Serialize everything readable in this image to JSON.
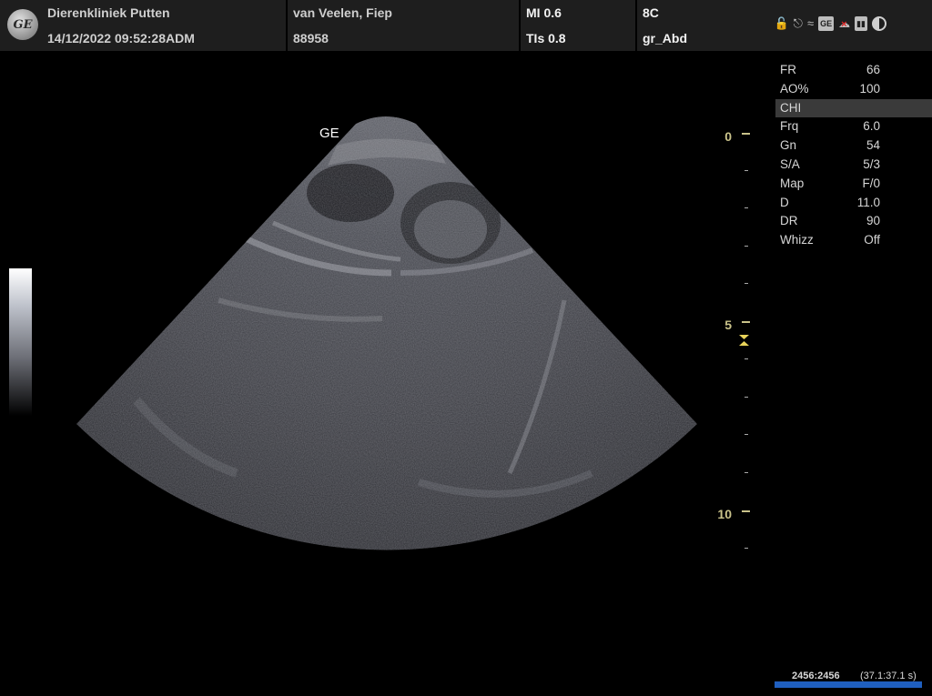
{
  "header": {
    "clinic_name": "Dierenkliniek Putten",
    "datetime": "14/12/2022 09:52:28ADM",
    "patient_name": "van Veelen, Fiep",
    "patient_id": "88958",
    "mi": "MI 0.6",
    "tis": "TIs 0.8",
    "probe": "8C",
    "preset": "gr_Abd",
    "logo_text": "GE"
  },
  "status_icons": [
    "lock-icon",
    "usb-icon",
    "wifi-icon",
    "printer-icon",
    "cloud-disconnected-icon",
    "battery-icon",
    "brightness-icon"
  ],
  "image": {
    "ge_mark": "GE"
  },
  "depth_scale": {
    "labels": [
      "0",
      "5",
      "10"
    ],
    "units_max": 11
  },
  "parameters": [
    {
      "label": "FR",
      "value": "66"
    },
    {
      "label": "AO%",
      "value": "100"
    },
    {
      "label": "CHI",
      "value": ""
    },
    {
      "label": "Frq",
      "value": "6.0"
    },
    {
      "label": "Gn",
      "value": "54"
    },
    {
      "label": "S/A",
      "value": "5/3"
    },
    {
      "label": "Map",
      "value": "F/0"
    },
    {
      "label": "D",
      "value": "11.0"
    },
    {
      "label": "DR",
      "value": "90"
    },
    {
      "label": "Whizz",
      "value": "Off"
    }
  ],
  "cine": {
    "frames": "2456:2456",
    "time": "(37.1:37.1 s)"
  },
  "colors": {
    "header_bg": "#1e1e1e",
    "scale_color": "#c9c28a",
    "cine_bar": "#1f5fbf"
  }
}
